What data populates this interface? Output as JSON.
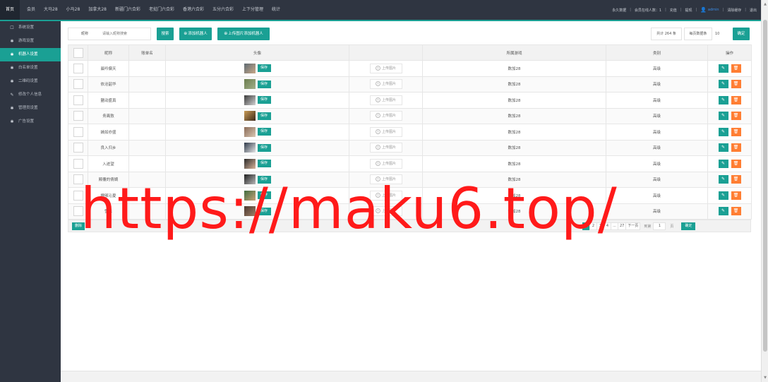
{
  "topnav": [
    "首页",
    "会员",
    "大马28",
    "小马28",
    "加拿大28",
    "新疆门六合彩",
    "老挝门六合彩",
    "香港六合彩",
    "五分六合彩",
    "上下分管理",
    "统计"
  ],
  "topright": {
    "items": [
      "永久数据",
      "会员在线人数：1",
      "充值",
      "提现",
      "admin",
      "清除缓存",
      "退出"
    ]
  },
  "sidebar": [
    {
      "icon": "square-icon",
      "glyph": "☐",
      "label": "系统设置"
    },
    {
      "icon": "gear-icon",
      "glyph": "✱",
      "label": "游戏设置"
    },
    {
      "icon": "gear-icon",
      "glyph": "✱",
      "label": "机器人设置"
    },
    {
      "icon": "gear-icon",
      "glyph": "✱",
      "label": "白名单设置"
    },
    {
      "icon": "gear-icon",
      "glyph": "✱",
      "label": "二维码设置"
    },
    {
      "icon": "pencil-icon",
      "glyph": "✎",
      "label": "修改个人信息"
    },
    {
      "icon": "gear-icon",
      "glyph": "✱",
      "label": "管理员设置"
    },
    {
      "icon": "gear-icon",
      "glyph": "✱",
      "label": "广告设置"
    }
  ],
  "toolbar": {
    "search_label": "昵称",
    "search_placeholder": "请输入昵称搜索",
    "search_btn": "搜索",
    "add_btn": "添加机器人",
    "upload_add_btn": "上传图片添加机器人",
    "total": "共计 264 条",
    "perpage_label": "每页数据条",
    "perpage_value": "10",
    "confirm": "确定"
  },
  "table": {
    "headers": [
      "",
      "昵称",
      "账单名",
      "头像",
      "",
      "所属游戏",
      "类别",
      "操作"
    ],
    "save_label": "保存",
    "upload_label": "上传图片",
    "rows": [
      {
        "nick": "晨吟偏天",
        "game": "数加28",
        "cat": "高级",
        "c1": "#5d6b73",
        "c2": "#c9a889"
      },
      {
        "nick": "依沧韶华",
        "game": "数加28",
        "cat": "高级",
        "c1": "#6b7d4e",
        "c2": "#a3b08a"
      },
      {
        "nick": "鹽动盛真",
        "game": "数加28",
        "cat": "高级",
        "c1": "#3a3a3a",
        "c2": "#d2d2d2"
      },
      {
        "nick": "务离敖",
        "game": "数加28",
        "cat": "高级",
        "c1": "#c99b55",
        "c2": "#3d2a1b"
      },
      {
        "nick": "嫣如亦盛",
        "game": "数加28",
        "cat": "高级",
        "c1": "#8a6b57",
        "c2": "#d9c7b3"
      },
      {
        "nick": "良入归乡",
        "game": "数加28",
        "cat": "高级",
        "c1": "#2f3a4a",
        "c2": "#e6e6e6"
      },
      {
        "nick": "入迹望",
        "game": "数加28",
        "cat": "高级",
        "c1": "#2a2a2a",
        "c2": "#d9b49a"
      },
      {
        "nick": "殿覆的倩嫡",
        "game": "数加28",
        "cat": "高级",
        "c1": "#1f1f1f",
        "c2": "#b9b9b9"
      },
      {
        "nick": "擅够沁夏",
        "game": "数加28",
        "cat": "高级",
        "c1": "#3f6d3f",
        "c2": "#c8a17a"
      },
      {
        "nick": "雪乐",
        "game": "数加28",
        "cat": "高级",
        "c1": "#4a3a32",
        "c2": "#a07f66"
      }
    ]
  },
  "footer": {
    "delete_label": "删除",
    "pages": [
      "1",
      "2",
      "3",
      "4",
      "...",
      "27",
      "下一页"
    ],
    "goto_label": "到第",
    "goto_value": "1",
    "goto_unit": "页",
    "goto_btn": "确定"
  },
  "watermark": "https://maku6.top/",
  "colors": {
    "accent": "#1aa094",
    "danger": "#ff7e33",
    "header": "#2f3541",
    "watermark": "#ff1a1a"
  }
}
